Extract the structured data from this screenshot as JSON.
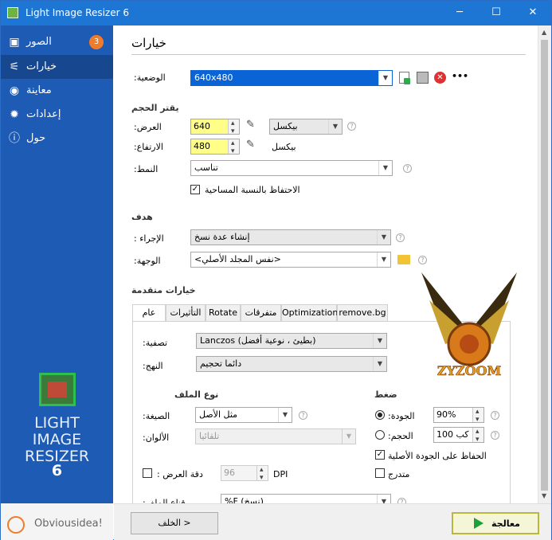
{
  "window": {
    "title": "Light Image Resizer 6",
    "minimize": "─",
    "maximize": "☐",
    "close": "✕"
  },
  "sidebar": {
    "items": [
      {
        "label": "الصور",
        "icon": "images-icon",
        "glyph": "▣",
        "badge": "3"
      },
      {
        "label": "خيارات",
        "icon": "sliders-icon",
        "glyph": "⚟",
        "active": true
      },
      {
        "label": "معاينة",
        "icon": "eye-icon",
        "glyph": "◉"
      },
      {
        "label": "إعدادات",
        "icon": "gear-icon",
        "glyph": "✹"
      },
      {
        "label": "حول",
        "icon": "info-icon",
        "glyph": "ⓘ"
      }
    ],
    "logo_lines": [
      "LIGHT",
      "IMAGE",
      "RESIZER"
    ],
    "logo_version": "6",
    "brand": "Obviousidea!"
  },
  "main": {
    "heading": "خيارات",
    "profile": {
      "label": ":الوضعية",
      "value": "640x480",
      "more": "•••"
    },
    "size_section": "يقتر الحجم",
    "width": {
      "label": ":العرض",
      "value": "640",
      "unit": "بيكسل"
    },
    "height": {
      "label": ":الارتفاع",
      "value": "480",
      "unit": "بيكسل"
    },
    "mode": {
      "label": ":النمط",
      "value": "تناسب"
    },
    "keep_ratio": {
      "label": "الاحتفاظ بالنسبة المساحية",
      "checked": true,
      "mark": "✓"
    },
    "target_section": "هدف",
    "action": {
      "label": ": الإجراء",
      "value": "إنشاء عدة نسخ"
    },
    "destination": {
      "label": ":الوجهة",
      "value": "<نفس المجلد الأصلي>"
    },
    "advanced_section": "خيارات متقدمة",
    "tabs": [
      "عام",
      "التأثيرات",
      "Rotate",
      "متفرقات",
      "Optimization",
      "remove.bg"
    ],
    "filter": {
      "label": ":تصفية",
      "value": "Lanczos (بطيئ ، نوعية أفضل)"
    },
    "approach": {
      "label": ":النهج",
      "value": "دائما تحجيم"
    },
    "file_type_section": "نوع الملف",
    "format": {
      "label": ":الصيغة",
      "value": "مثل الأصل"
    },
    "colors": {
      "label": ":الألوان",
      "value": "تلقائيا"
    },
    "compression_section": "ضغط",
    "quality": {
      "label": ":الجودة",
      "value": "90%"
    },
    "size": {
      "label": ":الحجم",
      "value": "100",
      "unit": "كب"
    },
    "keep_quality": {
      "label": "الحفاظ على الجودة الأصلية",
      "checked": true,
      "mark": "✓"
    },
    "progressive": {
      "label": "متدرج",
      "checked": false
    },
    "dpi": {
      "label": ": دقة العرض",
      "value": "96",
      "unit": "DPI"
    },
    "file_mask": {
      "label": ":قناع الملف",
      "value": "%F (نسخ)"
    }
  },
  "watermark": {
    "text": "ZYZOOM"
  },
  "footer": {
    "back": "الخلف >",
    "process": "معالجة"
  },
  "colors": {
    "sidebar": "#1e5bb5",
    "titlebar": "#1e76d4",
    "accent": "#f07c2a",
    "highlight": "#ffff88",
    "selection": "#0a64d6"
  }
}
